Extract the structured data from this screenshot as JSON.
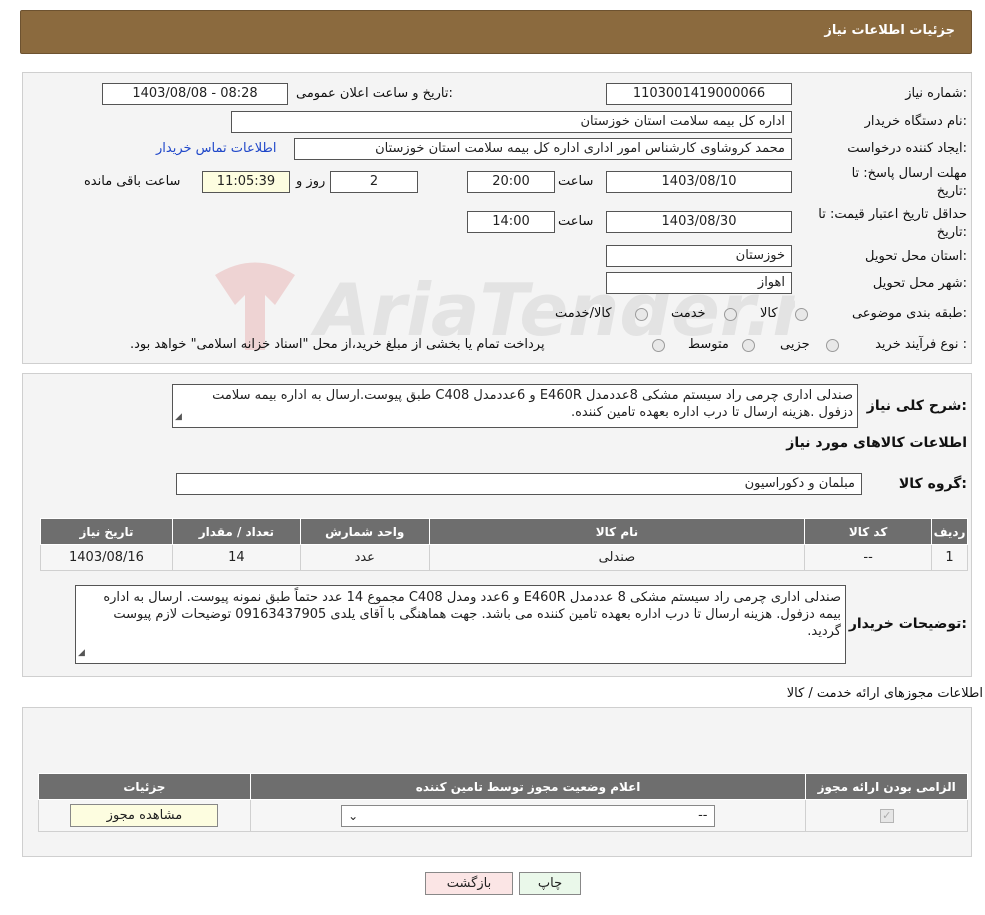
{
  "header": {
    "title": "جزئیات اطلاعات نیاز"
  },
  "form": {
    "need_number_label": "شماره نیاز:",
    "need_number": "1103001419000066",
    "announce_label": "تاریخ و ساعت اعلان عمومی:",
    "announce_value": "1403/08/08 - 08:28",
    "buyer_org_label": "نام دستگاه خریدار:",
    "buyer_org": "اداره کل بیمه سلامت استان خوزستان",
    "requester_label": "ایجاد کننده درخواست:",
    "requester": "محمد کروشاوی کارشناس امور اداری اداره کل بیمه سلامت استان خوزستان",
    "contact_link": "اطلاعات تماس خریدار",
    "deadline_label_1": "مهلت ارسال پاسخ: تا",
    "deadline_label_2": "تاریخ:",
    "deadline_date": "1403/08/10",
    "time_label": "ساعت",
    "deadline_time": "20:00",
    "days_value": "2",
    "days_label": "روز و",
    "remaining_time": "11:05:39",
    "remaining_label": "ساعت باقی مانده",
    "validity_label_1": "حداقل تاریخ اعتبار قیمت: تا",
    "validity_label_2": "تاریخ:",
    "validity_date": "1403/08/30",
    "validity_time": "14:00",
    "province_label": "استان محل تحویل:",
    "province": "خوزستان",
    "city_label": "شهر محل تحویل:",
    "city": "اهواز",
    "category_label": "طبقه بندی موضوعی:",
    "category_options": [
      "کالا",
      "خدمت",
      "کالا/خدمت"
    ],
    "process_label": "نوع فرآیند خرید :",
    "process_options": [
      "جزیی",
      "متوسط"
    ],
    "payment_note": "پرداخت تمام یا بخشی از مبلغ خرید،از محل \"اسناد خزانه اسلامی\" خواهد بود."
  },
  "details": {
    "summary_label": "شرح کلی نیاز:",
    "summary": "صندلی اداری چرمی راد سیستم مشکی 8عددمدل E460R و 6عددمدل C408 طبق پیوست.ارسال به اداره بیمه سلامت دزفول .هزینه ارسال تا درب اداره  بعهده تامین کننده.",
    "goods_info_title": "اطلاعات کالاهای مورد نیاز",
    "goods_group_label": "گروه کالا:",
    "goods_group": "مبلمان و دکوراسیون",
    "table": {
      "headers": [
        "ردیف",
        "کد کالا",
        "نام کالا",
        "واحد شمارش",
        "تعداد / مقدار",
        "تاریخ نیاز"
      ],
      "rows": [
        [
          "1",
          "--",
          "صندلی",
          "عدد",
          "14",
          "1403/08/16"
        ]
      ]
    },
    "buyer_notes_label": "توضیحات خریدار:",
    "buyer_notes": "صندلی اداری چرمی راد سیستم مشکی 8 عددمدل E460R و 6عدد ومدل C408 مجموع 14 عدد حتماً طبق نمونه پیوست. ارسال به اداره بیمه دزفول. هزینه ارسال تا درب اداره بعهده تامین کننده می باشد. جهت هماهنگی با آقای یلدی 09163437905 توضیحات لازم پیوست گردید."
  },
  "permits": {
    "title": "اطلاعات مجوزهای ارائه خدمت / کالا",
    "headers": [
      "الزامی بودن ارائه مجوز",
      "اعلام وضعیت مجوز توسط تامین کننده",
      "جزئیات"
    ],
    "select_value": "--",
    "view_button": "مشاهده مجوز"
  },
  "buttons": {
    "print": "چاپ",
    "back": "بازگشت"
  },
  "watermark": "AriaTender.neT"
}
